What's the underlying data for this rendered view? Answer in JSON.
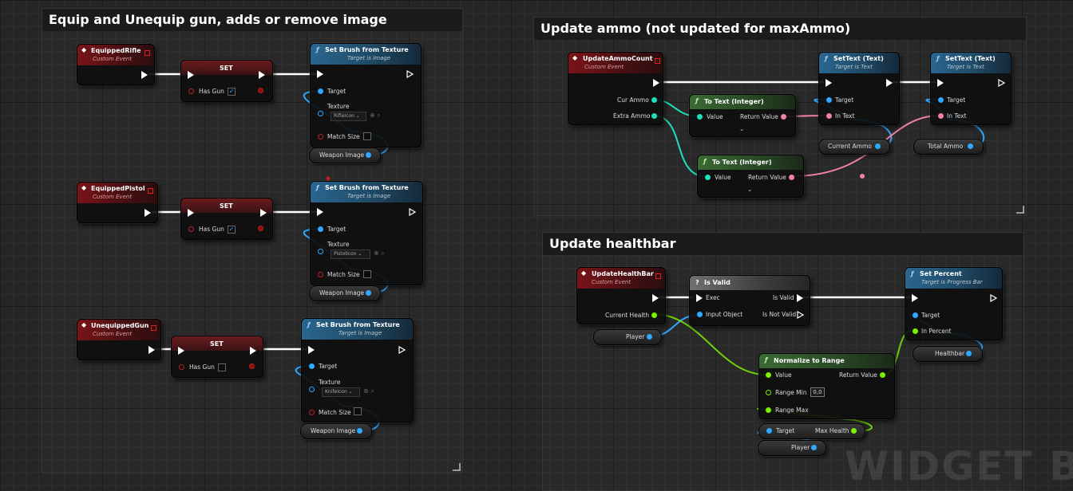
{
  "comments": [
    {
      "title": "Equip and Unequip gun, adds or remove image"
    },
    {
      "title": "Update ammo (not updated for maxAmmo)"
    },
    {
      "title": "Update healthbar"
    }
  ],
  "nodes": {
    "equipped_rifle": {
      "title": "EquippedRifle",
      "subtitle": "Custom Event"
    },
    "equipped_pistol": {
      "title": "EquippedPistol",
      "subtitle": "Custom Event"
    },
    "unequipped_gun": {
      "title": "UnequippedGun",
      "subtitle": "Custom Event"
    },
    "set1": {
      "title": "SET",
      "pin": "Has Gun",
      "checked": "✓"
    },
    "set2": {
      "title": "SET",
      "pin": "Has Gun",
      "checked": "✓"
    },
    "set3": {
      "title": "SET",
      "pin": "Has Gun",
      "checked": ""
    },
    "brush1": {
      "title": "Set Brush from Texture",
      "subtitle": "Target is Image",
      "target": "Target",
      "texture": "Texture",
      "texture_value": "RifleIcon",
      "match_size": "Match Size"
    },
    "brush2": {
      "title": "Set Brush from Texture",
      "subtitle": "Target is Image",
      "target": "Target",
      "texture": "Texture",
      "texture_value": "PistolIcon",
      "match_size": "Match Size"
    },
    "brush3": {
      "title": "Set Brush from Texture",
      "subtitle": "Target is Image",
      "target": "Target",
      "texture": "Texture",
      "texture_value": "KnifeIcon",
      "match_size": "Match Size"
    },
    "weapon_image_1": {
      "label": "Weapon Image"
    },
    "weapon_image_2": {
      "label": "Weapon Image"
    },
    "weapon_image_3": {
      "label": "Weapon Image"
    },
    "update_ammo": {
      "title": "UpdateAmmoCount",
      "subtitle": "Custom Event",
      "pin1": "Cur Ammo",
      "pin2": "Extra Ammo"
    },
    "to_text_1": {
      "title": "To Text (Integer)",
      "in": "Value",
      "out": "Return Value"
    },
    "to_text_2": {
      "title": "To Text (Integer)",
      "in": "Value",
      "out": "Return Value"
    },
    "settext1": {
      "title": "SetText (Text)",
      "subtitle": "Target is Text",
      "target": "Target",
      "in_text": "In Text"
    },
    "settext2": {
      "title": "SetText (Text)",
      "subtitle": "Target is Text",
      "target": "Target",
      "in_text": "In Text"
    },
    "current_ammo": {
      "label": "Current Ammo"
    },
    "total_ammo": {
      "label": "Total Ammo"
    },
    "update_health": {
      "title": "UpdateHealthBar",
      "subtitle": "Custom Event",
      "pin": "Current Health"
    },
    "player1": {
      "label": "Player"
    },
    "player2": {
      "label": "Player"
    },
    "is_valid": {
      "title": "Is Valid",
      "exec": "Exec",
      "input": "Input Object",
      "is_valid": "Is Valid",
      "not_valid": "Is Not Valid"
    },
    "set_percent": {
      "title": "Set Percent",
      "subtitle": "Target is Progress Bar",
      "target": "Target",
      "in_percent": "In Percent"
    },
    "healthbar": {
      "label": "Healthbar"
    },
    "normalize": {
      "title": "Normalize to Range",
      "value": "Value",
      "return": "Return Value",
      "range_min": "Range Min",
      "range_min_value": "0,0",
      "range_max": "Range Max"
    },
    "max_health": {
      "target": "Target",
      "label": "Max Health"
    }
  },
  "watermark": "WIDGET BL",
  "colors": {
    "exec": "#ffffff",
    "object": "#2fa8ff",
    "int": "#1fe0bd",
    "text": "#f080a8",
    "float": "#7bf000",
    "event_header": "#7a1418",
    "function_header": "#2a6690",
    "pure_header": "#3a6a33"
  }
}
